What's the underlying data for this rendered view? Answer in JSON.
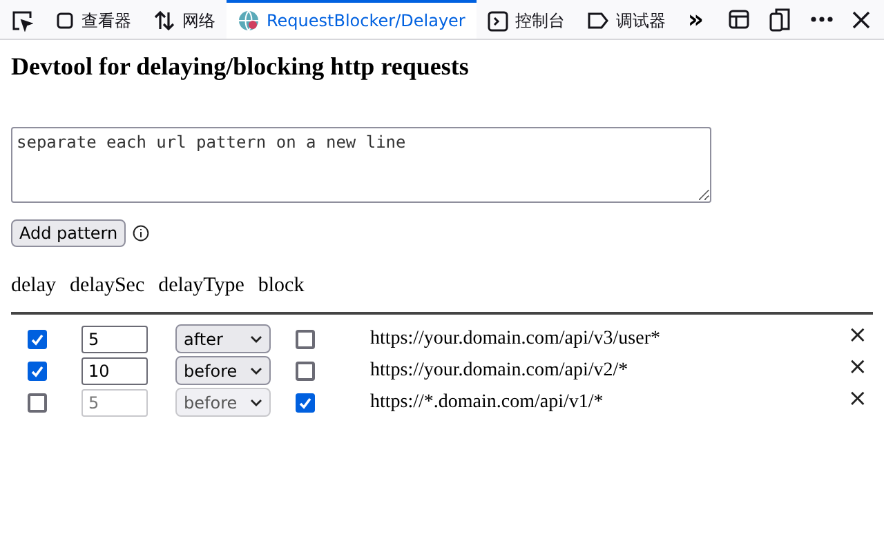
{
  "toolbar": {
    "tabs": [
      {
        "kind": "picker",
        "selected": false
      },
      {
        "kind": "inspector",
        "label": "查看器",
        "selected": false
      },
      {
        "kind": "network",
        "label": "网络",
        "selected": false
      },
      {
        "kind": "globe",
        "label": "RequestBlocker/Delayer",
        "selected": true
      },
      {
        "kind": "console",
        "label": "控制台",
        "selected": false
      },
      {
        "kind": "debugger",
        "label": "调试器",
        "selected": false
      }
    ],
    "overflow": "»"
  },
  "heading": "Devtool for delaying/blocking http requests",
  "pattern_input": {
    "placeholder": "separate each url pattern on a new line"
  },
  "add_button": "Add pattern",
  "columns": [
    "delay",
    "delaySec",
    "delayType",
    "block"
  ],
  "rows": [
    {
      "delay": true,
      "delaySec": "5",
      "delayType": "after",
      "block": false,
      "url": "https://your.domain.com/api/v3/user*",
      "remove": "×"
    },
    {
      "delay": true,
      "delaySec": "10",
      "delayType": "before",
      "block": false,
      "url": "https://your.domain.com/api/v2/*",
      "remove": "×"
    },
    {
      "delay": false,
      "delaySec": "5",
      "delayType": "before",
      "block": true,
      "url": "https://*.domain.com/api/v1/*",
      "remove": "×"
    }
  ]
}
